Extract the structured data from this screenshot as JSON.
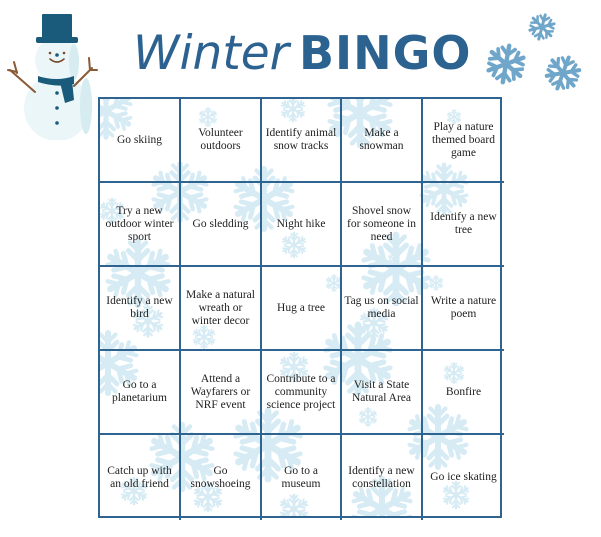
{
  "title": {
    "light": "Winter",
    "bold": "BINGO"
  },
  "colors": {
    "title": "#2c6290",
    "grid_border": "#2f6490",
    "decor_snowflake": "#6fa6c9",
    "bg_snowflake": "#d6ebf4",
    "hat": "#1a5a7a",
    "scarf": "#1a5a7a",
    "arms": "#8a5a35"
  },
  "decor": {
    "snowman_icon": "snowman-icon",
    "snowflake_icon": "snowflake-icon"
  },
  "board": {
    "rows": [
      [
        "Go skiing",
        "Volunteer outdoors",
        "Identify animal snow tracks",
        "Make a snowman",
        "Play a nature themed board game"
      ],
      [
        "Try a new outdoor winter sport",
        "Go sledding",
        "Night hike",
        "Shovel snow for someone in need",
        "Identify a new tree"
      ],
      [
        "Identify a new bird",
        "Make a natural wreath or winter decor",
        "Hug a tree",
        "Tag us on social media",
        "Write a nature poem"
      ],
      [
        "Go to a planetarium",
        "Attend a Wayfarers or NRF event",
        "Contribute to a community science project",
        "Visit a State Natural Area",
        "Bonfire"
      ],
      [
        "Catch up with an old friend",
        "Go snowshoeing",
        "Go to a museum",
        "Identify a new constellation",
        "Go ice skating"
      ]
    ]
  }
}
